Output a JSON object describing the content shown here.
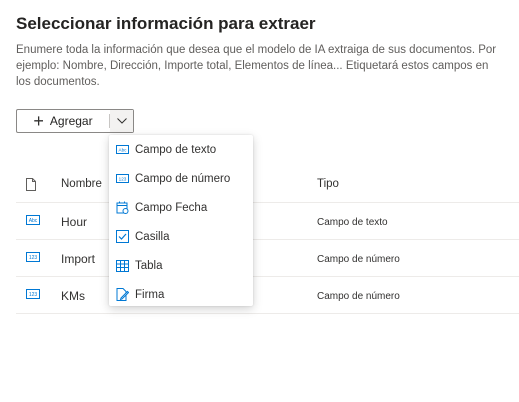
{
  "page": {
    "title": "Seleccionar información para extraer",
    "description": "Enumere toda la información que desea que el modelo de IA extraiga de sus documentos. Por ejemplo: Nombre, Dirección, Importe total, Elementos de línea... Etiquetará estos campos en los documentos."
  },
  "toolbar": {
    "add_label": "Agregar"
  },
  "table": {
    "columns": {
      "name": "Nombre",
      "type": "Tipo"
    },
    "rows": [
      {
        "icon": "text-field-icon",
        "name": "Hour",
        "type": "Campo de texto"
      },
      {
        "icon": "number-field-icon",
        "name": "Import",
        "type": "Campo de número"
      },
      {
        "icon": "number-field-icon",
        "name": "KMs",
        "type": "Campo de número"
      }
    ]
  },
  "menu": {
    "items": [
      {
        "icon": "text-field-icon",
        "label": "Campo de texto"
      },
      {
        "icon": "number-field-icon",
        "label": "Campo de número"
      },
      {
        "icon": "calendar-icon",
        "label": "Campo Fecha"
      },
      {
        "icon": "checkbox-icon",
        "label": "Casilla"
      },
      {
        "icon": "table-icon",
        "label": "Tabla"
      },
      {
        "icon": "signature-icon",
        "label": "Firma"
      }
    ]
  },
  "colors": {
    "accent": "#0078d4",
    "border": "#8a8886",
    "divider": "#edebe9"
  }
}
